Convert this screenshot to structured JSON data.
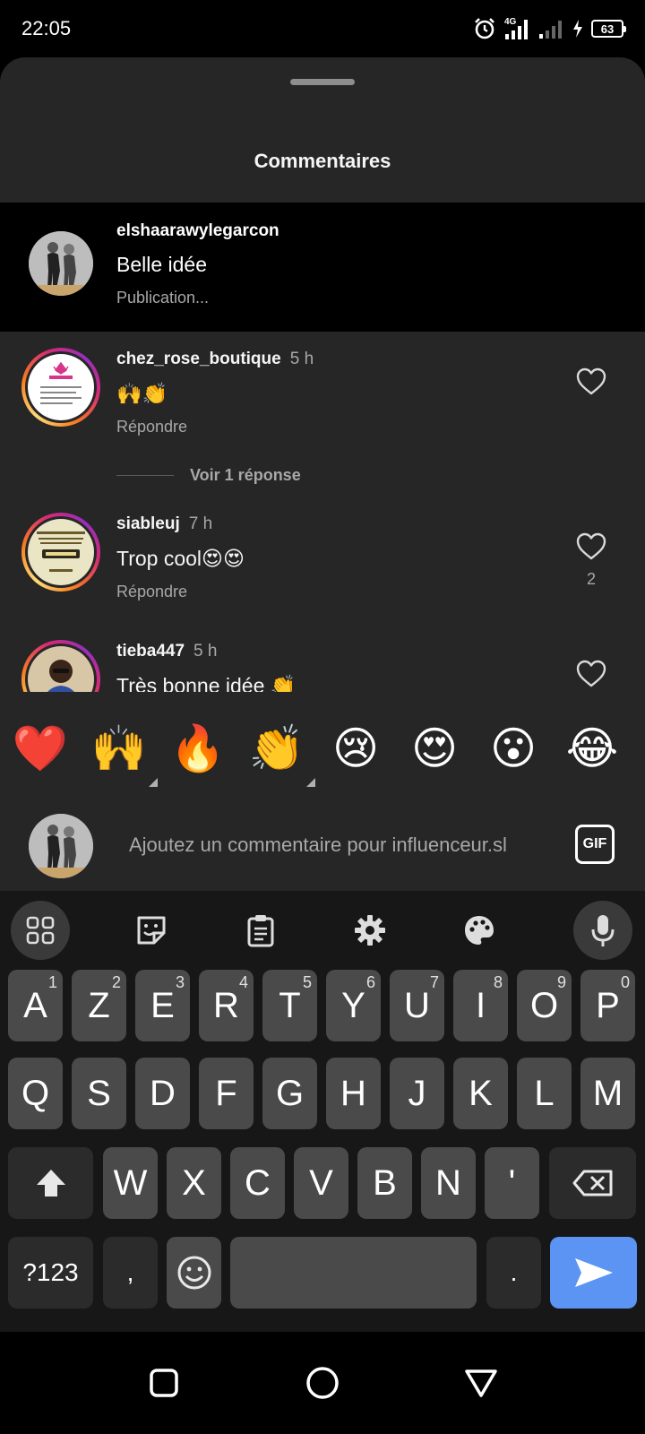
{
  "status_bar": {
    "time": "22:05",
    "network": "4G",
    "battery": "63"
  },
  "sheet": {
    "title": "Commentaires"
  },
  "post": {
    "username": "elshaarawylegarcon",
    "caption": "Belle idée",
    "subtitle": "Publication..."
  },
  "comments": [
    {
      "username": "chez_rose_boutique",
      "age": "5 h",
      "text": "🙌👏",
      "reply_label": "Répondre",
      "likes": "",
      "view_replies": "Voir 1 réponse"
    },
    {
      "username": "siableuj",
      "age": "7 h",
      "text": "Trop cool😍😍",
      "reply_label": "Répondre",
      "likes": "2"
    },
    {
      "username": "tieba447",
      "age": "5 h",
      "text": "Très bonne idée 👏",
      "reply_label": "",
      "likes": ""
    }
  ],
  "reactions": [
    "❤️",
    "🙌",
    "🔥",
    "👏",
    "😢",
    "😍",
    "😮",
    "😂"
  ],
  "composer": {
    "placeholder": "Ajoutez un commentaire pour influenceur.sl",
    "gif_label": "GIF"
  },
  "keyboard": {
    "row1": [
      {
        "key": "A",
        "hint": "1"
      },
      {
        "key": "Z",
        "hint": "2"
      },
      {
        "key": "E",
        "hint": "3"
      },
      {
        "key": "R",
        "hint": "4"
      },
      {
        "key": "T",
        "hint": "5"
      },
      {
        "key": "Y",
        "hint": "6"
      },
      {
        "key": "U",
        "hint": "7"
      },
      {
        "key": "I",
        "hint": "8"
      },
      {
        "key": "O",
        "hint": "9"
      },
      {
        "key": "P",
        "hint": "0"
      }
    ],
    "row2": [
      "Q",
      "S",
      "D",
      "F",
      "G",
      "H",
      "J",
      "K",
      "L",
      "M"
    ],
    "row3": [
      "W",
      "X",
      "C",
      "V",
      "B",
      "N",
      "'"
    ],
    "symbols": "?123",
    "comma": ",",
    "period": "."
  },
  "icons": {
    "toolbar": [
      "grid-icon",
      "sticker-icon",
      "clipboard-icon",
      "settings-icon",
      "palette-icon",
      "microphone-icon"
    ],
    "nav": [
      "recent-apps-icon",
      "home-icon",
      "back-icon"
    ]
  }
}
